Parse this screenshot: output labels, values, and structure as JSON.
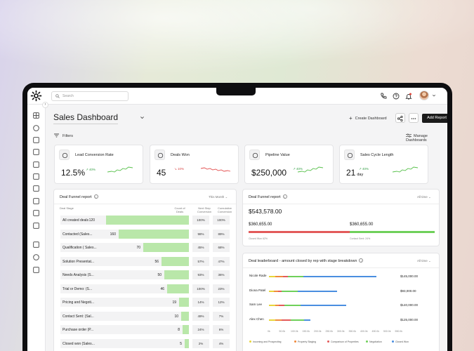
{
  "search": {
    "placeholder": "Search"
  },
  "header": {
    "title": "Sales Dashboard",
    "create_dashboard": "Create Dashboard",
    "add_report": "Add Report",
    "filters": "Filters",
    "manage_dashboards": "Manage Dashboards"
  },
  "kpis": [
    {
      "label": "Lead Conversion Rate",
      "value": "12.5%",
      "delta": "40%",
      "trend": "up",
      "icon": "chart-icon"
    },
    {
      "label": "Deals Won",
      "value": "45",
      "delta": "10%",
      "trend": "down",
      "icon": "medal-icon"
    },
    {
      "label": "Pipeline Value",
      "value": "$250,000",
      "delta": "40%",
      "trend": "up",
      "icon": "dollar-icon"
    },
    {
      "label": "Sales Cycle Length",
      "value": "21",
      "unit": "day",
      "delta": "40%",
      "trend": "up",
      "icon": "timer-icon"
    }
  ],
  "funnel": {
    "title": "Deal Funnel report",
    "range": "This Month",
    "columns": [
      "Deal Stage",
      "Count of Deals",
      "Next Step Conversion",
      "Cumulative Conversion"
    ],
    "rows": [
      {
        "stage": "All created deals",
        "count": "120",
        "next": "100%",
        "cum": "100%"
      },
      {
        "stage": "Contacted (Sales...",
        "count": "160",
        "next": "98%",
        "cum": "89%"
      },
      {
        "stage": "Qualification ( Sales...",
        "count": "70",
        "next": "45%",
        "cum": "68%"
      },
      {
        "stage": "Solution Presentat...",
        "count": "56",
        "next": "57%",
        "cum": "47%"
      },
      {
        "stage": "Needs Analysis (S...",
        "count": "50",
        "next": "93%",
        "cum": "36%"
      },
      {
        "stage": "Trial or Demo: (S...",
        "count": "46",
        "next": "100%",
        "cum": "23%"
      },
      {
        "stage": "Pricing and Negoti...",
        "count": "19",
        "next": "14%",
        "cum": "12%"
      },
      {
        "stage": "Contact Sent: (Sal...",
        "count": "10",
        "next": "49%",
        "cum": "7%"
      },
      {
        "stage": "Purchase order (P...",
        "count": "8",
        "next": "24%",
        "cum": "6%"
      },
      {
        "stage": "Closed won (Sales...",
        "count": "5",
        "next": "2%",
        "cum": "4%"
      },
      {
        "stage": "Closed lost (Sales...",
        "count": "2",
        "next": "1%",
        "cum": "2%"
      }
    ],
    "bar_fraction": [
      1.0,
      0.85,
      0.55,
      0.33,
      0.3,
      0.26,
      0.12,
      0.09,
      0.08,
      0.05,
      0.02
    ]
  },
  "deal_summary": {
    "title": "Deal Funnel report",
    "range": "All time",
    "total": "$543,578.00",
    "won_value": "$360,655.00",
    "lost_value": "$360,655.00",
    "won_label": "Closed Won 62%",
    "lost_label": "Contact Sent: 24%",
    "lost_color": "#e35a5a",
    "won_color": "#6fd05a"
  },
  "leaderboard": {
    "title": "Deal leaderboard - amount closed by rep with stage breakdown",
    "range": "All time",
    "reps": [
      {
        "name": "Nicole Rade",
        "value": "$145,000.00",
        "segments": [
          0.05,
          0.06,
          0.04,
          0.12,
          0.58
        ]
      },
      {
        "name": "Diona Patel",
        "value": "$93,000.00",
        "segments": [
          0.04,
          0.03,
          0.03,
          0.13,
          0.31
        ]
      },
      {
        "name": "Sam Lee",
        "value": "$140,000.00",
        "segments": [
          0.05,
          0.03,
          0.04,
          0.13,
          0.36
        ]
      },
      {
        "name": "Alex Chen",
        "value": "$125,000.00",
        "segments": [
          0.05,
          0.05,
          0.07,
          0.11,
          0.05
        ]
      }
    ],
    "ticks": [
      "0k",
      "50.0k",
      "100.0k",
      "150.0k",
      "200.0k",
      "250.0k",
      "300.0k",
      "350.0k",
      "400.0k",
      "450.0k",
      "500.0k",
      "550.0k"
    ],
    "legend": [
      {
        "label": "Incoming and Prospecting",
        "color": "#e8d53a"
      },
      {
        "label": "Property Staging",
        "color": "#f08a3c"
      },
      {
        "label": "Comparison of Properties",
        "color": "#e35a5a"
      },
      {
        "label": "Negotiation",
        "color": "#6fd05a"
      },
      {
        "label": "Closed Won",
        "color": "#4a8ee0"
      }
    ]
  }
}
